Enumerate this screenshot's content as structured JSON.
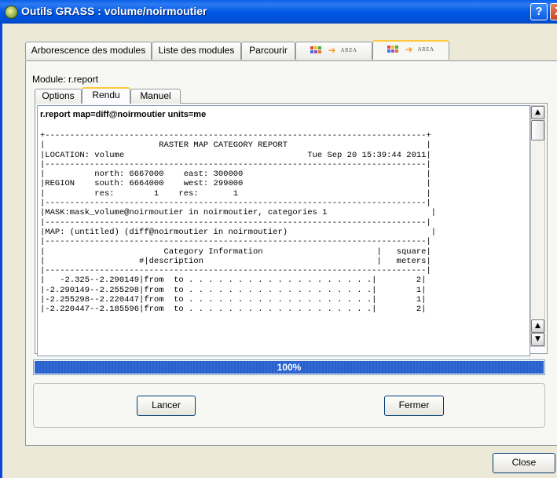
{
  "window": {
    "title": "Outils GRASS : volume/noirmoutier",
    "help_label": "?",
    "close_label": "X"
  },
  "main_tabs": [
    {
      "label": "Arborescence des modules"
    },
    {
      "label": "Liste des modules"
    },
    {
      "label": "Parcourir"
    },
    {
      "label": "AREA",
      "icon": "area-module-icon"
    },
    {
      "label": "AREA",
      "icon": "area-module-icon"
    }
  ],
  "module_label": "Module: r.report",
  "sub_tabs": [
    {
      "label": "Options"
    },
    {
      "label": "Rendu"
    },
    {
      "label": "Manuel"
    }
  ],
  "output": {
    "command": "r.report map=diff@noirmoutier units=me",
    "lines": [
      "+-----------------------------------------------------------------------------+",
      "|                       RASTER MAP CATEGORY REPORT                            |",
      "|LOCATION: volume                                     Tue Sep 20 15:39:44 2011|",
      "|-----------------------------------------------------------------------------|",
      "|          north: 6667000    east: 300000                                     |",
      "|REGION    south: 6664000    west: 299000                                     |",
      "|          res:        1    res:       1                                      |",
      "|-----------------------------------------------------------------------------|",
      "|MASK:mask_volume@noirmoutier in noirmoutier, categories 1                     |",
      "|-----------------------------------------------------------------------------|",
      "|MAP: (untitled) (diff@noirmoutier in noirmoutier)                             |",
      "|-----------------------------------------------------------------------------|",
      "|                        Category Information                       |   square|",
      "|                   #|description                                   |   meters|",
      "|-----------------------------------------------------------------------------|",
      "|   -2.325--2.290149|from  to . . . . . . . . . . . . . . . . . . .|        2|",
      "|-2.290149--2.255298|from  to . . . . . . . . . . . . . . . . . . .|        1|",
      "|-2.255298--2.220447|from  to . . . . . . . . . . . . . . . . . . .|        1|",
      "|-2.220447--2.185596|from  to . . . . . . . . . . . . . . . . . . .|        2|"
    ]
  },
  "progress": {
    "value": 100,
    "label": "100%"
  },
  "buttons": {
    "run": "Lancer",
    "close_module": "Fermer",
    "close": "Close"
  },
  "colors": {
    "titlebar": "#0058E6",
    "progress_fill": "#2C64CF",
    "tab_highlight": "#FFC83C"
  }
}
